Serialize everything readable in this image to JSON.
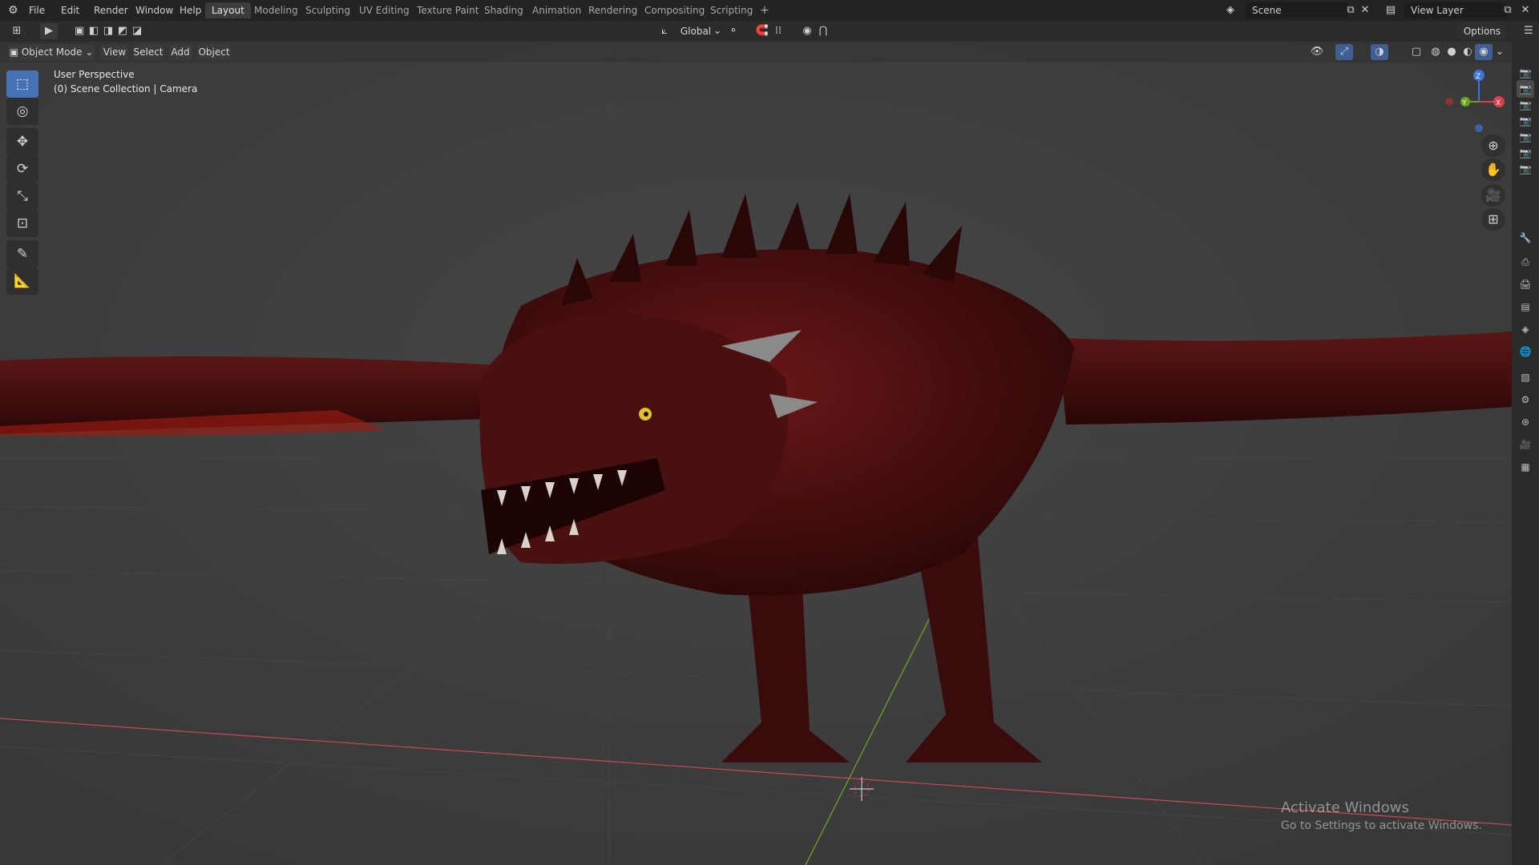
{
  "menu": [
    "File",
    "Edit",
    "Render",
    "Window",
    "Help"
  ],
  "workspaces": [
    "Layout",
    "Modeling",
    "Sculpting",
    "UV Editing",
    "Texture Paint",
    "Shading",
    "Animation",
    "Rendering",
    "Compositing",
    "Scripting"
  ],
  "add_workspace": "+",
  "scene": {
    "label": "Scene"
  },
  "view_layer": {
    "label": "View Layer"
  },
  "header": {
    "orientation": "Global",
    "options": "Options"
  },
  "viewport_header": {
    "mode": "Object Mode",
    "menus": [
      "View",
      "Select",
      "Add",
      "Object"
    ]
  },
  "overlay": {
    "perspective": "User Perspective",
    "collection": "(0) Scene Collection | Camera"
  },
  "gizmo": {
    "z": "Z",
    "x": "X",
    "y": "Y"
  },
  "watermark": {
    "title": "Activate Windows",
    "subtitle": "Go to Settings to activate Windows."
  },
  "colors": {
    "accent": "#4772b3",
    "x_axis": "#d9404c",
    "y_axis": "#6aa41e",
    "z_axis": "#3c75d9",
    "dragon": "#5a1414"
  },
  "icons": {
    "tools": [
      "select-box-icon",
      "cursor-icon",
      "move-icon",
      "rotate-icon",
      "scale-icon",
      "transform-icon",
      "annotate-icon",
      "measure-icon"
    ],
    "nav": [
      "zoom-icon",
      "hand-pan-icon",
      "camera-view-icon",
      "ortho-grid-icon"
    ]
  }
}
